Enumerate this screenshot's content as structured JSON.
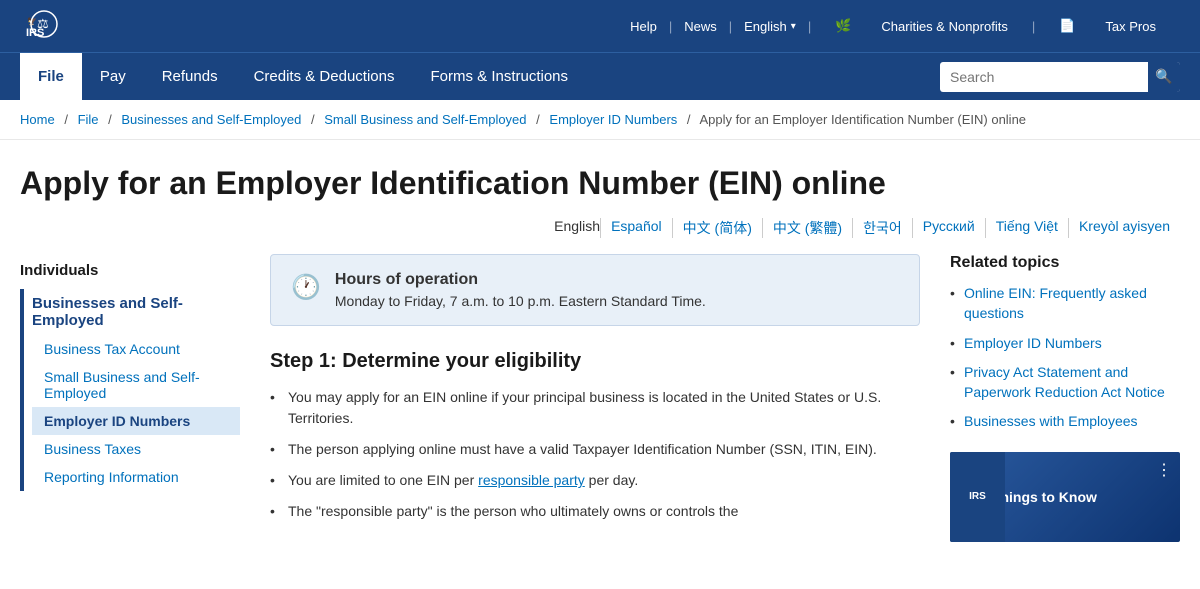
{
  "topbar": {
    "help": "Help",
    "news": "News",
    "language": "English",
    "charities": "Charities & Nonprofits",
    "taxpros": "Tax Pros"
  },
  "nav": {
    "items": [
      {
        "label": "File",
        "active": true
      },
      {
        "label": "Pay",
        "active": false
      },
      {
        "label": "Refunds",
        "active": false
      },
      {
        "label": "Credits & Deductions",
        "active": false
      },
      {
        "label": "Forms & Instructions",
        "active": false
      }
    ],
    "search_placeholder": "Search"
  },
  "breadcrumb": {
    "items": [
      {
        "label": "Home",
        "href": "#"
      },
      {
        "label": "File",
        "href": "#"
      },
      {
        "label": "Businesses and Self-Employed",
        "href": "#"
      },
      {
        "label": "Small Business and Self-Employed",
        "href": "#"
      },
      {
        "label": "Employer ID Numbers",
        "href": "#"
      }
    ],
    "current": "Apply for an Employer Identification Number (EIN) online"
  },
  "page_title": "Apply for an Employer Identification Number (EIN) online",
  "languages": [
    {
      "label": "English",
      "href": "#",
      "is_plain": true
    },
    {
      "label": "Español",
      "href": "#"
    },
    {
      "label": "中文 (简体)",
      "href": "#"
    },
    {
      "label": "中文 (繁體)",
      "href": "#"
    },
    {
      "label": "한국어",
      "href": "#"
    },
    {
      "label": "Русский",
      "href": "#"
    },
    {
      "label": "Tiếng Việt",
      "href": "#"
    },
    {
      "label": "Kreyòl ayisyen",
      "href": "#"
    }
  ],
  "sidebar": {
    "section_title": "Individuals",
    "active_section": "Businesses and Self-Employed",
    "items": [
      {
        "label": "Business Tax Account",
        "active": false
      },
      {
        "label": "Small Business and Self-Employed",
        "active": false
      },
      {
        "label": "Employer ID Numbers",
        "active": true
      },
      {
        "label": "Business Taxes",
        "active": false
      },
      {
        "label": "Reporting Information",
        "active": false
      }
    ]
  },
  "hours_box": {
    "title": "Hours of operation",
    "text": "Monday to Friday, 7 a.m. to 10 p.m. Eastern Standard Time."
  },
  "step1": {
    "title": "Step 1: Determine your eligibility",
    "bullets": [
      "You may apply for an EIN online if your principal business is located in the United States or U.S. Territories.",
      "The person applying online must have a valid Taxpayer Identification Number (SSN, ITIN, EIN).",
      "You are limited to one EIN per responsible party per day.",
      "The \"responsible party\" is the person who ultimately owns or controls the"
    ],
    "responsible_party_link": "responsible party"
  },
  "related_topics": {
    "title": "Related topics",
    "items": [
      {
        "label": "Online EIN: Frequently asked questions",
        "href": "#"
      },
      {
        "label": "Employer ID Numbers",
        "href": "#"
      },
      {
        "label": "Privacy Act Statement and Paperwork Reduction Act Notice",
        "href": "#"
      },
      {
        "label": "Businesses with Employees",
        "href": "#"
      }
    ]
  },
  "video": {
    "title": "Five Things to Know",
    "irs_label": "IRS"
  }
}
